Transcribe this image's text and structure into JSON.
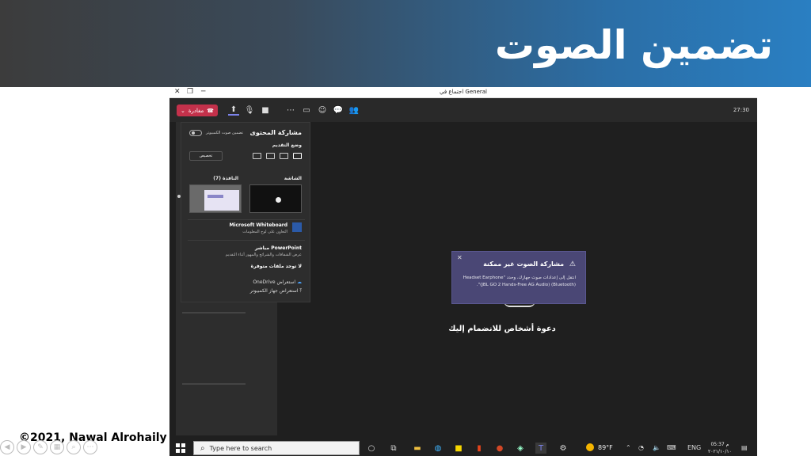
{
  "slide": {
    "title": "تضمين الصوت",
    "copyright": "©2021, Nawal Alrohaily"
  },
  "window": {
    "title": "اجتماع في General"
  },
  "toolbar": {
    "leave_label": "مغادرة",
    "time": "27:30"
  },
  "share_panel": {
    "heading": "مشاركة المحتوى",
    "include_audio_label": "تضمين صوت الكمبيوتر",
    "presenter_mode_label": "وضع التقديم",
    "customize_label": "تخصيص",
    "screen_label": "الشاشة",
    "window_label": "النافذة (7)",
    "whiteboard_title": "Microsoft Whiteboard",
    "whiteboard_sub": "التعاون على لوح المعلومات",
    "powerpoint_title": "PowerPoint مباشر",
    "powerpoint_sub": "عرض الشفافات والشرائح والمهور أثناء التقديم",
    "no_files_label": "لا توجد ملفات متوفرة",
    "onedrive_label": "استعراض OneDrive",
    "computer_label": "استعراض جهاز الكمبيوتر"
  },
  "notice": {
    "title": "مشاركة الصوت غير ممكنة",
    "body": "انتقل إلى إعدادات صوت جهازك، وحدد \"Headset Earphone (JBL GO 2 Hands-Free AG Audio) (Bluetooth)\"."
  },
  "meeting": {
    "invite_text": "دعوة أشخاص للانضمام إليك"
  },
  "taskbar": {
    "search_placeholder": "Type here to search",
    "temperature": "89°F",
    "language": "ENG",
    "time": "05:37 م",
    "date": "٢٠٢١/١٠/١٠"
  }
}
